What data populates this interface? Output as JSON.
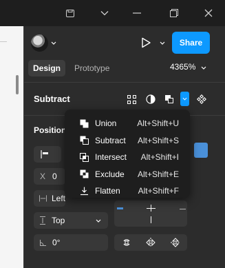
{
  "header": {
    "share_label": "Share",
    "tabs": [
      {
        "label": "Design",
        "active": true
      },
      {
        "label": "Prototype",
        "active": false
      }
    ],
    "zoom_label": "4365%"
  },
  "boolean": {
    "title": "Subtract",
    "menu": [
      {
        "icon": "union-icon",
        "label": "Union",
        "shortcut": "Alt+Shift+U"
      },
      {
        "icon": "subtract-icon",
        "label": "Subtract",
        "shortcut": "Alt+Shift+S"
      },
      {
        "icon": "intersect-icon",
        "label": "Intersect",
        "shortcut": "Alt+Shift+I"
      },
      {
        "icon": "exclude-icon",
        "label": "Exclude",
        "shortcut": "Alt+Shift+E"
      },
      {
        "icon": "flatten-icon",
        "label": "Flatten",
        "shortcut": "Alt+Shift+F"
      }
    ]
  },
  "position": {
    "title": "Position",
    "x_label": "X",
    "x_value": "0",
    "horizontal_constraint": "Left",
    "vertical_constraint": "Top",
    "rotation_value": "0°"
  },
  "colors": {
    "accent": "#0d99ff",
    "panel_bg": "#2c2c2c",
    "menu_bg": "#1e1e1e",
    "canvas_bg": "#f5f5f5"
  }
}
